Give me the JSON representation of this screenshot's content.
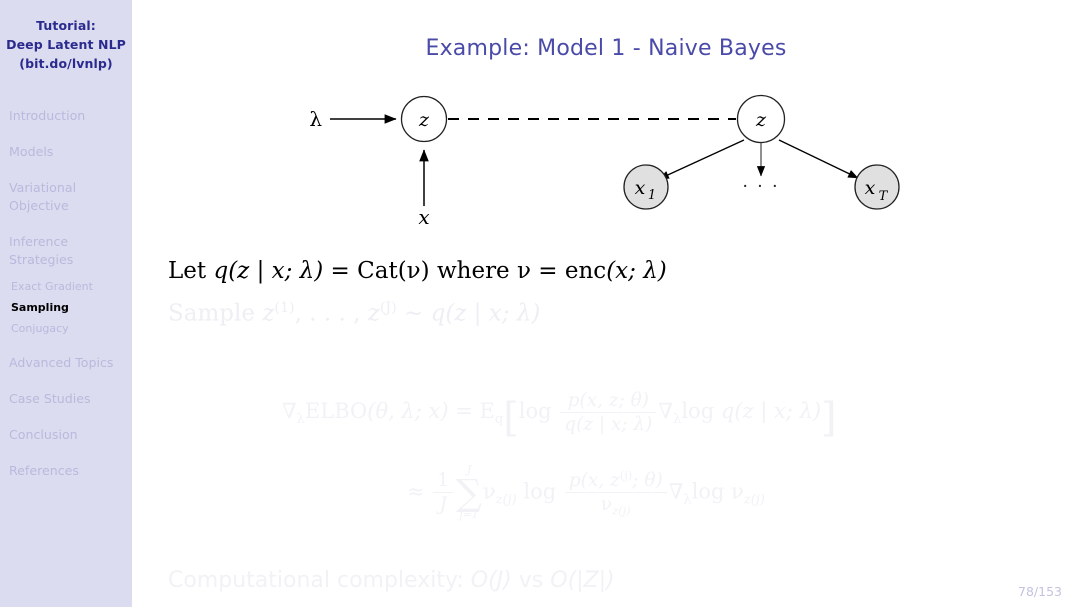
{
  "sidebar": {
    "title_lines": [
      "Tutorial:",
      "Deep Latent NLP",
      "(bit.do/lvnlp)"
    ],
    "sections": [
      {
        "label": "Introduction"
      },
      {
        "label": "Models"
      },
      {
        "label": "Variational\nObjective"
      },
      {
        "label": "Inference\nStrategies"
      },
      {
        "label": "Advanced Topics"
      },
      {
        "label": "Case Studies"
      },
      {
        "label": "Conclusion"
      },
      {
        "label": "References"
      }
    ],
    "subsections": [
      {
        "label": "Exact Gradient",
        "active": false
      },
      {
        "label": "Sampling",
        "active": true
      },
      {
        "label": "Conjugacy",
        "active": false
      }
    ]
  },
  "slide": {
    "title": "Example: Model 1 - Naive Bayes",
    "page_number": "78/153",
    "accent_color": "#4a4aa8",
    "sidebar_bg": "#dcdcf0",
    "sidebar_title_color": "#2b2b8f",
    "nav_inactive_color": "#b9b9dd",
    "faded_text_color": "#f2f2f6"
  },
  "diagram": {
    "lambda_label": "λ",
    "x_input_label": "x",
    "left_node_label": "z",
    "right_node_label": "z",
    "observed_nodes": [
      {
        "label": "x",
        "subscript": "1"
      },
      {
        "label": "x",
        "subscript": "T"
      }
    ],
    "ellipsis": "· · ·",
    "node_fill_latent": "#ffffff",
    "node_fill_observed": "#e0e0e0",
    "node_stroke": "#000000"
  },
  "body": {
    "line_let": {
      "prefix": "Let ",
      "q": "q",
      "args": "(z | x; λ)",
      "equals": " = ",
      "cat": "Cat",
      "nu_arg": "(ν)",
      "where": " where ",
      "nu": "ν",
      "equals2": " = ",
      "enc": "enc",
      "enc_args": "(x; λ)"
    },
    "line_sample": {
      "prefix": "Sample ",
      "z1": "z",
      "sup1": "(1)",
      "dots": ", . . . , ",
      "zJ": "z",
      "supJ": "(J)",
      "sim": " ∼ ",
      "q": "q",
      "qargs": "(z | x; λ)"
    },
    "equation": {
      "grad": "∇",
      "grad_sub": "λ",
      "elbo": "ELBO",
      "elbo_args": "(θ, λ; x)",
      "equals": " = ",
      "expect": "E",
      "expect_sub": "q",
      "bracket_open": "[",
      "log": "log ",
      "frac1_num": "p(x, z; θ)",
      "frac1_den": "q(z | x; λ)",
      "grad2": "∇",
      "grad2_sub": "λ",
      "log2": "log ",
      "q2": "q(z | x; λ)",
      "bracket_close": "]",
      "approx": "≈ ",
      "frac_one": "1",
      "frac_J": "J",
      "sum_sym": "∑",
      "sum_upper": "J",
      "sum_lower": "j=1",
      "nu": "ν",
      "nu_sub": "z(j)",
      "log3": " log ",
      "frac2_num": "p(x, z",
      "frac2_num_sup": "(j)",
      "frac2_num_tail": "; θ)",
      "frac2_den": "ν",
      "frac2_den_sub": "z(j)",
      "grad3": "∇",
      "grad3_sub": "λ",
      "log4": "log ",
      "nu2": "ν",
      "nu2_sub": "z(j)"
    },
    "line_complexity": {
      "prefix": "Computational complexity: ",
      "o1": "O(J)",
      "vs": " vs ",
      "o2": "O(|Z|)"
    }
  }
}
